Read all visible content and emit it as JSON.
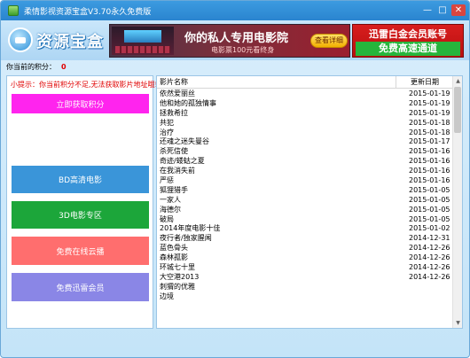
{
  "window": {
    "title": "柔情影视资源宝盒V3.70永久免费版",
    "minimize": "—",
    "maximize": "□",
    "close": "✕"
  },
  "header": {
    "logo_text": "资源宝盒",
    "banner_movie": {
      "main": "你的私人专用电影院",
      "sub": "电影票100元看终身",
      "button": "查看详细"
    },
    "banner_vip": {
      "top": "迅雷白金会员账号",
      "bottom": "免费高速通道"
    }
  },
  "points": {
    "label": "你当前的积分：",
    "value": "0"
  },
  "sidebar": {
    "tip": "小提示：你当前积分不足,无法获取影片地址哦!",
    "buttons": [
      {
        "label": "立即获取积分",
        "color": "#ff24ee"
      },
      {
        "label": "BD高清电影",
        "color": "#3a95d9"
      },
      {
        "label": "3D电影专区",
        "color": "#1ca63a"
      },
      {
        "label": "免费在线云播",
        "color": "#ff6e6e"
      },
      {
        "label": "免费迅雷会员",
        "color": "#8a86e6"
      }
    ]
  },
  "film_list": {
    "columns": [
      "影片名称",
      "更新日期"
    ],
    "rows": [
      {
        "name": "依然爱丽丝",
        "date": "2015-01-19"
      },
      {
        "name": "他和她的孤独情事",
        "date": "2015-01-19"
      },
      {
        "name": "拯救希拉",
        "date": "2015-01-19"
      },
      {
        "name": "共犯",
        "date": "2015-01-18"
      },
      {
        "name": "治疗",
        "date": "2015-01-18"
      },
      {
        "name": "还魂之迷失曼谷",
        "date": "2015-01-17"
      },
      {
        "name": "杀死信使",
        "date": "2015-01-16"
      },
      {
        "name": "奇迹/蝼蛄之夏",
        "date": "2015-01-16"
      },
      {
        "name": "在我消失前",
        "date": "2015-01-16"
      },
      {
        "name": "严惩",
        "date": "2015-01-16"
      },
      {
        "name": "狐狸猎手",
        "date": "2015-01-05"
      },
      {
        "name": "一家人",
        "date": "2015-01-05"
      },
      {
        "name": "海德尔",
        "date": "2015-01-05"
      },
      {
        "name": "破局",
        "date": "2015-01-05"
      },
      {
        "name": "2014年度电影十佳",
        "date": "2015-01-02"
      },
      {
        "name": "夜行者/独家腥闻",
        "date": "2014-12-31"
      },
      {
        "name": "蓝色骨头",
        "date": "2014-12-26"
      },
      {
        "name": "森林孤影",
        "date": "2014-12-26"
      },
      {
        "name": "环城七十里",
        "date": "2014-12-26"
      },
      {
        "name": "大空港2013",
        "date": "2014-12-26"
      },
      {
        "name": "刺猬的优雅",
        "date": ""
      },
      {
        "name": "边境",
        "date": ""
      }
    ],
    "scroll_up": "▲",
    "scroll_down": "▼"
  }
}
